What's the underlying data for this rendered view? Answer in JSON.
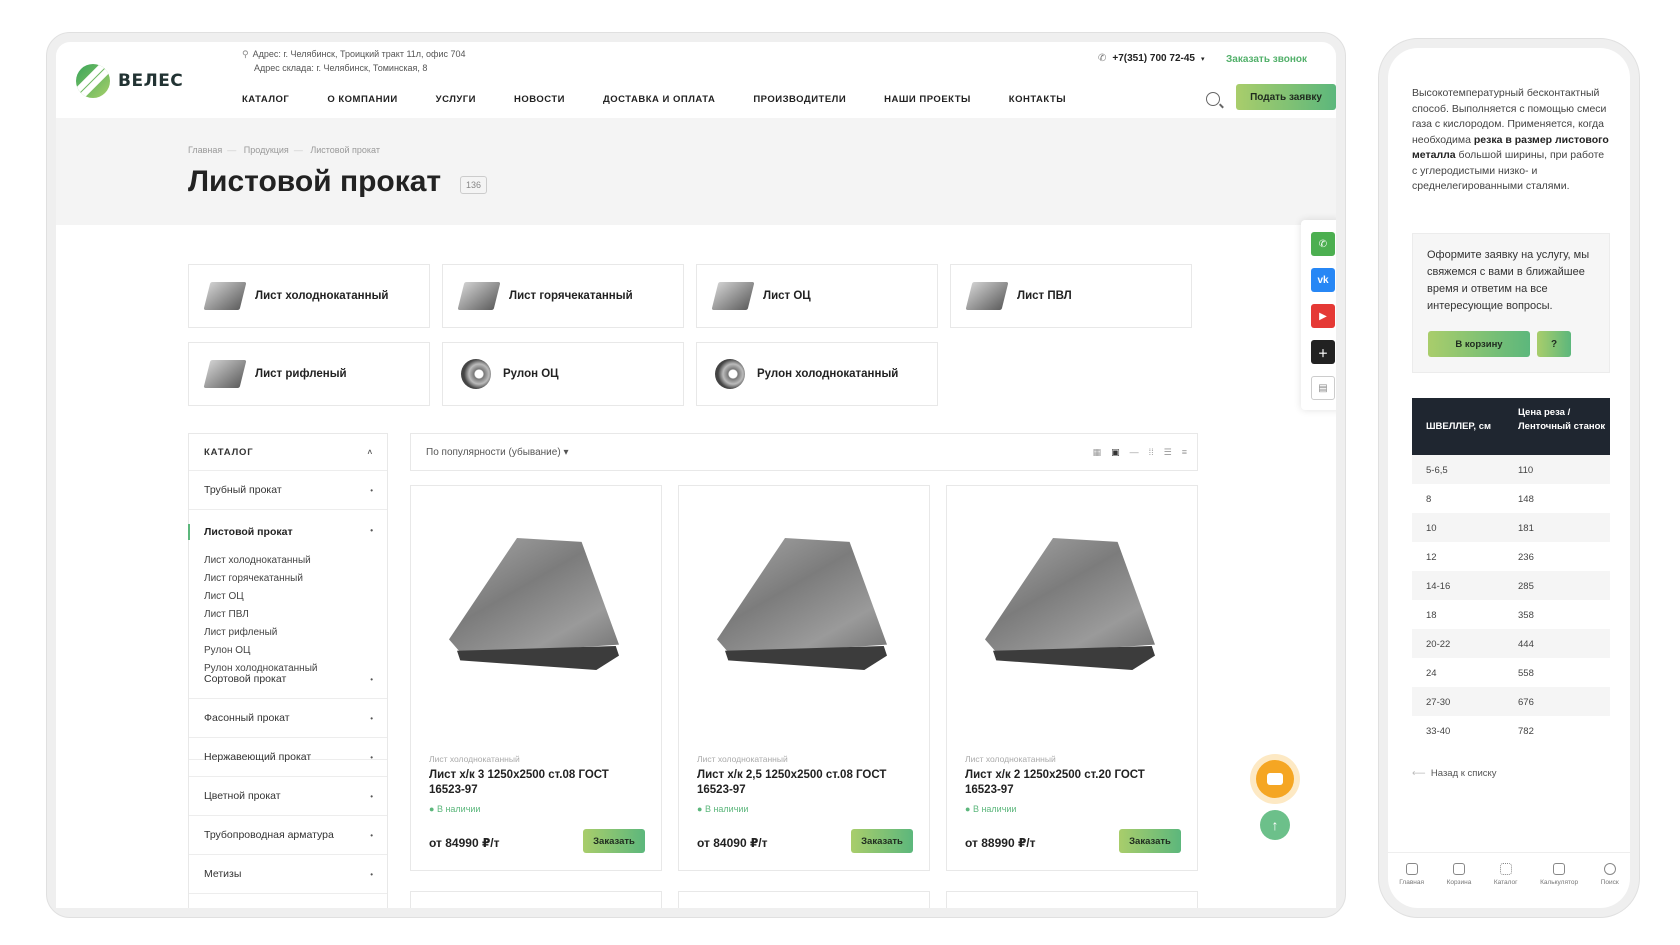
{
  "header": {
    "logo_text": "ВЕЛЕС",
    "address_office": "Адрес: г. Челябинск, Троицкий тракт 11л, офис 704",
    "address_warehouse": "Адрес склада: г. Челябинск, Томинская, 8",
    "phone": "+7(351) 700 72-45",
    "callback_label": "Заказать звонок",
    "request_button": "Подать заявку",
    "nav": [
      "КАТАЛОГ",
      "О КОМПАНИИ",
      "УСЛУГИ",
      "НОВОСТИ",
      "ДОСТАВКА И ОПЛАТА",
      "ПРОИЗВОДИТЕЛИ",
      "НАШИ ПРОЕКТЫ",
      "КОНТАКТЫ"
    ]
  },
  "breadcrumbs": [
    "Главная",
    "Продукция",
    "Листовой прокат"
  ],
  "page": {
    "title": "Листовой прокат",
    "count": "136"
  },
  "categories": [
    "Лист холоднокатанный",
    "Лист горячекатанный",
    "Лист ОЦ",
    "Лист ПВЛ",
    "Лист рифленый",
    "Рулон ОЦ",
    "Рулон холоднокатанный"
  ],
  "sidebar": {
    "heading": "КАТАЛОГ",
    "items": [
      "Трубный прокат",
      "Листовой прокат",
      "Сортовой прокат",
      "Фасонный прокат",
      "Нержавеющий прокат",
      "Цветной прокат",
      "Трубопроводная арматура",
      "Метизы"
    ],
    "subitems": [
      "Лист холоднокатанный",
      "Лист горячекатанный",
      "Лист ОЦ",
      "Лист ПВЛ",
      "Лист рифленый",
      "Рулон ОЦ",
      "Рулон холоднокатанный"
    ]
  },
  "sort": {
    "label": "По популярности (убывание)"
  },
  "products": [
    {
      "category": "Лист холоднокатанный",
      "name": "Лист х/к 3 1250х2500 ст.08 ГОСТ 16523-97",
      "stock": "В наличии",
      "price": "от 84990 ₽/т",
      "order": "Заказать"
    },
    {
      "category": "Лист холоднокатанный",
      "name": "Лист х/к 2,5 1250х2500 ст.08 ГОСТ 16523-97",
      "stock": "В наличии",
      "price": "от 84090 ₽/т",
      "order": "Заказать"
    },
    {
      "category": "Лист холоднокатанный",
      "name": "Лист х/к 2 1250х2500 ст.20 ГОСТ 16523-97",
      "stock": "В наличии",
      "price": "от 88990 ₽/т",
      "order": "Заказать"
    }
  ],
  "colors": {
    "accent": "#5cb77c",
    "accent_light": "#a9cd6b",
    "whatsapp": "#4caf50",
    "vk": "#2787f5",
    "youtube": "#e53935",
    "dark": "#1f2630",
    "chat": "#f5a623"
  },
  "mobile": {
    "text_before": "Высокотемпературный бесконтактный способ. Выполняется с помощью смеси газа с кислородом. Применяется, когда необходима ",
    "text_bold": "резка в размер листового металла",
    "text_after": " большой ширины, при работе с углеродистыми низко- и среднелегированными сталями.",
    "form_text": "Оформите заявку на услугу, мы свяжемся с вами в ближайшее время и ответим на все интересующие вопросы.",
    "cart_button": "В корзину",
    "question_button": "?",
    "table": {
      "col1": "ШВЕЛЛЕР, см",
      "col2": "Цена реза / Ленточный станок",
      "rows": [
        [
          "5-6,5",
          "110"
        ],
        [
          "8",
          "148"
        ],
        [
          "10",
          "181"
        ],
        [
          "12",
          "236"
        ],
        [
          "14-16",
          "285"
        ],
        [
          "18",
          "358"
        ],
        [
          "20-22",
          "444"
        ],
        [
          "24",
          "558"
        ],
        [
          "27-30",
          "676"
        ],
        [
          "33-40",
          "782"
        ]
      ]
    },
    "back_link": "Назад к списку",
    "tabbar": [
      "Главная",
      "Корзина",
      "Каталог",
      "Калькулятор",
      "Поиск"
    ]
  }
}
